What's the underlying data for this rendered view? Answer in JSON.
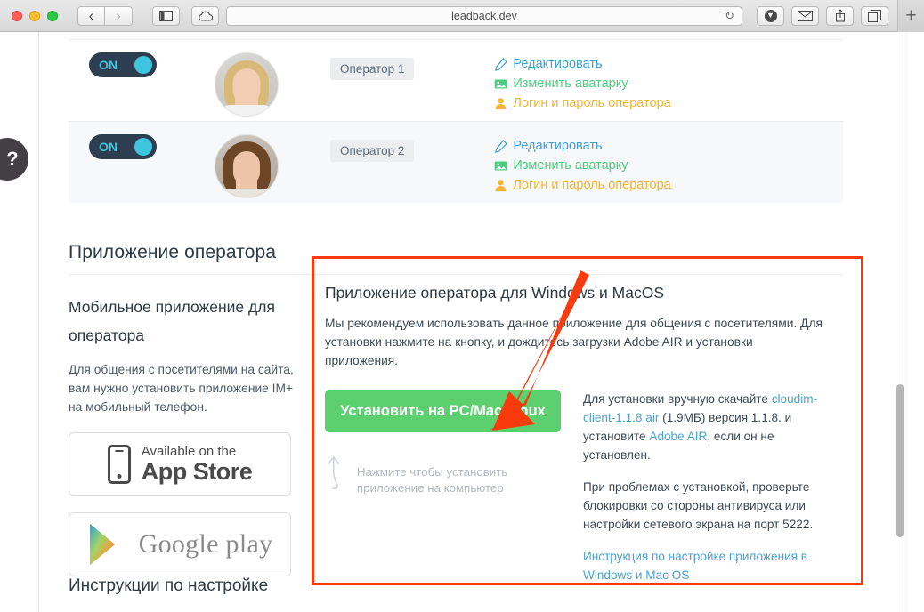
{
  "browser": {
    "url": "leadback.dev",
    "back_label": "‹",
    "forward_label": "›",
    "sidebar_icon": "sidebar-icon",
    "icloud_icon": "cloud-icon",
    "reload_label": "↻",
    "download_icon": "download-icon",
    "mail_icon": "mail-icon",
    "share_icon": "share-icon",
    "tabs_icon": "tabs-icon",
    "newtab_label": "+"
  },
  "help": {
    "label": "?"
  },
  "operators": {
    "rows": [
      {
        "toggle_label": "ON",
        "badge": "Оператор 1",
        "links": [
          {
            "label": "Редактировать",
            "icon": "pencil-icon"
          },
          {
            "label": "Изменить аватарку",
            "icon": "image-icon"
          },
          {
            "label": "Логин и пароль оператора",
            "icon": "user-icon"
          }
        ]
      },
      {
        "toggle_label": "ON",
        "badge": "Оператор 2",
        "links": [
          {
            "label": "Редактировать",
            "icon": "pencil-icon"
          },
          {
            "label": "Изменить аватарку",
            "icon": "image-icon"
          },
          {
            "label": "Логин и пароль оператора",
            "icon": "user-icon"
          }
        ]
      }
    ]
  },
  "section": {
    "title": "Приложение оператора"
  },
  "mobile": {
    "heading": "Мобильное приложение для оператора",
    "paragraph": "Для общения с посетителями на сайта, вам нужно установить приложение IM+ на мобильный телефон.",
    "appstore": {
      "line1": "Available on the",
      "line2": "App Store"
    },
    "googleplay": {
      "label": "Google play"
    }
  },
  "desktop": {
    "heading": "Приложение оператора для Windows и MacOS",
    "intro": "Мы рекомендуем использовать данное приложение для общения с посетителями. Для установки нажмите на кнопку, и дождитесь загрузки Adobe AIR и установки приложения.",
    "install_button": "Установить на PC/Mac/Linux",
    "hint": "Нажмите чтобы установить приложение на компьютер",
    "manual_text_1": "Для установки вручную скачайте ",
    "manual_link_1": "cloudim-client-1.1.8.air",
    "manual_text_2": " (1.9МБ) версия 1.1.8. и установите ",
    "manual_link_2": "Adobe AIR",
    "manual_text_3": ", если он не установлен.",
    "trouble": "При проблемах с установкой, проверьте блокировки со стороны антивируса или настройки сетевого экрана на порт 5222.",
    "guide_link": "Инструкция по настройке приложения в Windows и Mac OS"
  },
  "bottom": {
    "heading": "Инструкции по настройке"
  },
  "colors": {
    "accent_green": "#5cd06f",
    "toggle_navy": "#2d3e50",
    "toggle_cyan": "#3ec6e0",
    "link_blue": "#4ba3d1",
    "link_green": "#4bcf7e",
    "link_orange": "#f1b434",
    "annotation_red": "#f93a0c"
  }
}
